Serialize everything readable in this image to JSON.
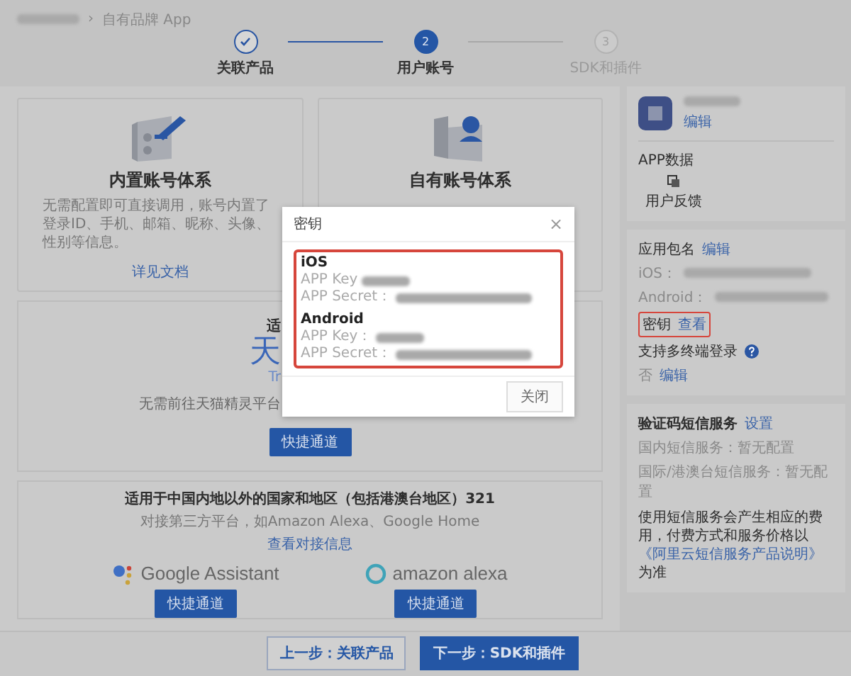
{
  "breadcrumb": {
    "separator": "›",
    "current": "自有品牌 App"
  },
  "steps": [
    {
      "label": "关联产品",
      "completed": true,
      "selected": false
    },
    {
      "number": "2",
      "label": "用户账号",
      "completed": false,
      "selected": true
    },
    {
      "number": "3",
      "label": "SDK和插件",
      "completed": false,
      "selected": false
    }
  ],
  "account_cards": [
    {
      "kind": "builtin",
      "title": "内置账号体系",
      "description": "无需配置即可直接调用，账号内置了登录ID、手机、邮箱、昵称、头像、性别等信息。",
      "link": "详见文档"
    },
    {
      "kind": "custom",
      "title": "自有账号体系"
    }
  ],
  "mainland_section": {
    "heading": "适",
    "logo_text": "天",
    "logo_subtext": "Tr",
    "description": "无需前往天猫精灵平台",
    "button": "快捷通道"
  },
  "overseas_section": {
    "heading": "适用于中国内地以外的国家和地区（包括港澳台地区）321",
    "description": "对接第三方平台，如Amazon Alexa、Google Home",
    "link": "查看对接信息",
    "platforms": [
      {
        "kind": "google",
        "name": "Google Assistant",
        "button": "快捷通道"
      },
      {
        "kind": "alexa",
        "name": "amazon alexa",
        "button": "快捷通道"
      }
    ]
  },
  "footer": {
    "prev": "上一步：关联产品",
    "next": "下一步：SDK和插件"
  },
  "sidebar": {
    "app": {
      "edit": "编辑"
    },
    "app_data": {
      "title": "APP数据",
      "items": [
        {
          "label": "用户反馈"
        }
      ]
    },
    "package": {
      "title": "应用包名",
      "edit": "编辑",
      "ios_label": "iOS：",
      "android_label": "Android："
    },
    "keys": {
      "label": "密钥",
      "link": "查看",
      "highlighted": true
    },
    "multi_login": {
      "label": "支持多终端登录",
      "value": "否",
      "edit": "编辑"
    },
    "sms": {
      "title": "验证码短信服务",
      "link": "设置",
      "lines": [
        "国内短信服务：暂无配置",
        "国际/港澳台短信服务：暂无配置"
      ],
      "note_before": "使用短信服务会产生相应的费用，付费方式和服务价格以",
      "note_link": "《阿里云短信服务产品说明》",
      "note_after": "为准"
    }
  },
  "modal": {
    "title": "密钥",
    "close": "×",
    "highlighted": true,
    "platforms": [
      {
        "name": "iOS",
        "key_label": "APP Key",
        "secret_label": "APP Secret："
      },
      {
        "name": "Android",
        "key_label": "APP Key：",
        "secret_label": "APP Secret："
      }
    ],
    "button": "关闭"
  }
}
